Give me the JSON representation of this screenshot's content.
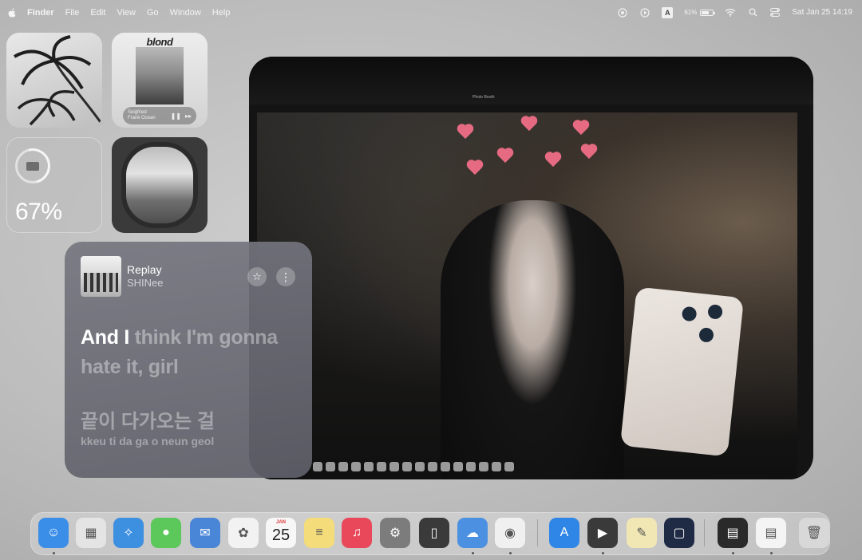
{
  "menubar": {
    "app": "Finder",
    "items": [
      "File",
      "Edit",
      "View",
      "Go",
      "Window",
      "Help"
    ],
    "battery_percent": "61%",
    "input_source": "A",
    "clock": "Sat Jan 25  14:19"
  },
  "widgets": {
    "album": {
      "title": "blond",
      "now_playing_song": "Seigfried",
      "now_playing_artist": "Frank Ocean"
    },
    "battery": {
      "percent_label": "67%",
      "level": 0.67
    }
  },
  "photo_window": {
    "title": "Photo Booth"
  },
  "music": {
    "song": "Replay",
    "artist": "SHINee",
    "lyric_active": "And I",
    "lyric_rest": " think I'm gonna hate it, girl",
    "lyric_next": "끝이 다가오는 걸",
    "lyric_romanized": "kkeu ti  da ga o neun  geol",
    "star_glyph": "☆",
    "more_glyph": "⋮"
  },
  "dock": {
    "calendar_month": "JAN",
    "calendar_day": "25",
    "apps": [
      {
        "name": "finder-app",
        "color": "#3b8ee8"
      },
      {
        "name": "launchpad-app",
        "color": "#e4e4e4"
      },
      {
        "name": "safari-app",
        "color": "#3d8fe0"
      },
      {
        "name": "messages-app",
        "color": "#5cc75a"
      },
      {
        "name": "mail-app",
        "color": "#4a86d8"
      },
      {
        "name": "photos-app",
        "color": "#f2f2f2"
      },
      {
        "name": "calendar-app",
        "color": "#f7f7f7"
      },
      {
        "name": "notes-app",
        "color": "#f4dc7a"
      },
      {
        "name": "music-app",
        "color": "#e8485a"
      },
      {
        "name": "settings-app",
        "color": "#7c7c7c"
      },
      {
        "name": "iphone-mirroring-app",
        "color": "#3a3a3a"
      },
      {
        "name": "icloud-app",
        "color": "#4c90e2"
      },
      {
        "name": "chrome-app",
        "color": "#f0f0f0"
      },
      {
        "name": "app-store-app",
        "color": "#2f86e6"
      },
      {
        "name": "quicktime-app",
        "color": "#3a3a3a"
      },
      {
        "name": "stickies-app",
        "color": "#f1e7b5"
      },
      {
        "name": "screen-app",
        "color": "#1f2b44"
      },
      {
        "name": "photo-booth-stack",
        "color": "#2a2a2a"
      },
      {
        "name": "documents-stack",
        "color": "#f4f4f4"
      },
      {
        "name": "trash",
        "color": "#d8d8d8"
      }
    ]
  }
}
